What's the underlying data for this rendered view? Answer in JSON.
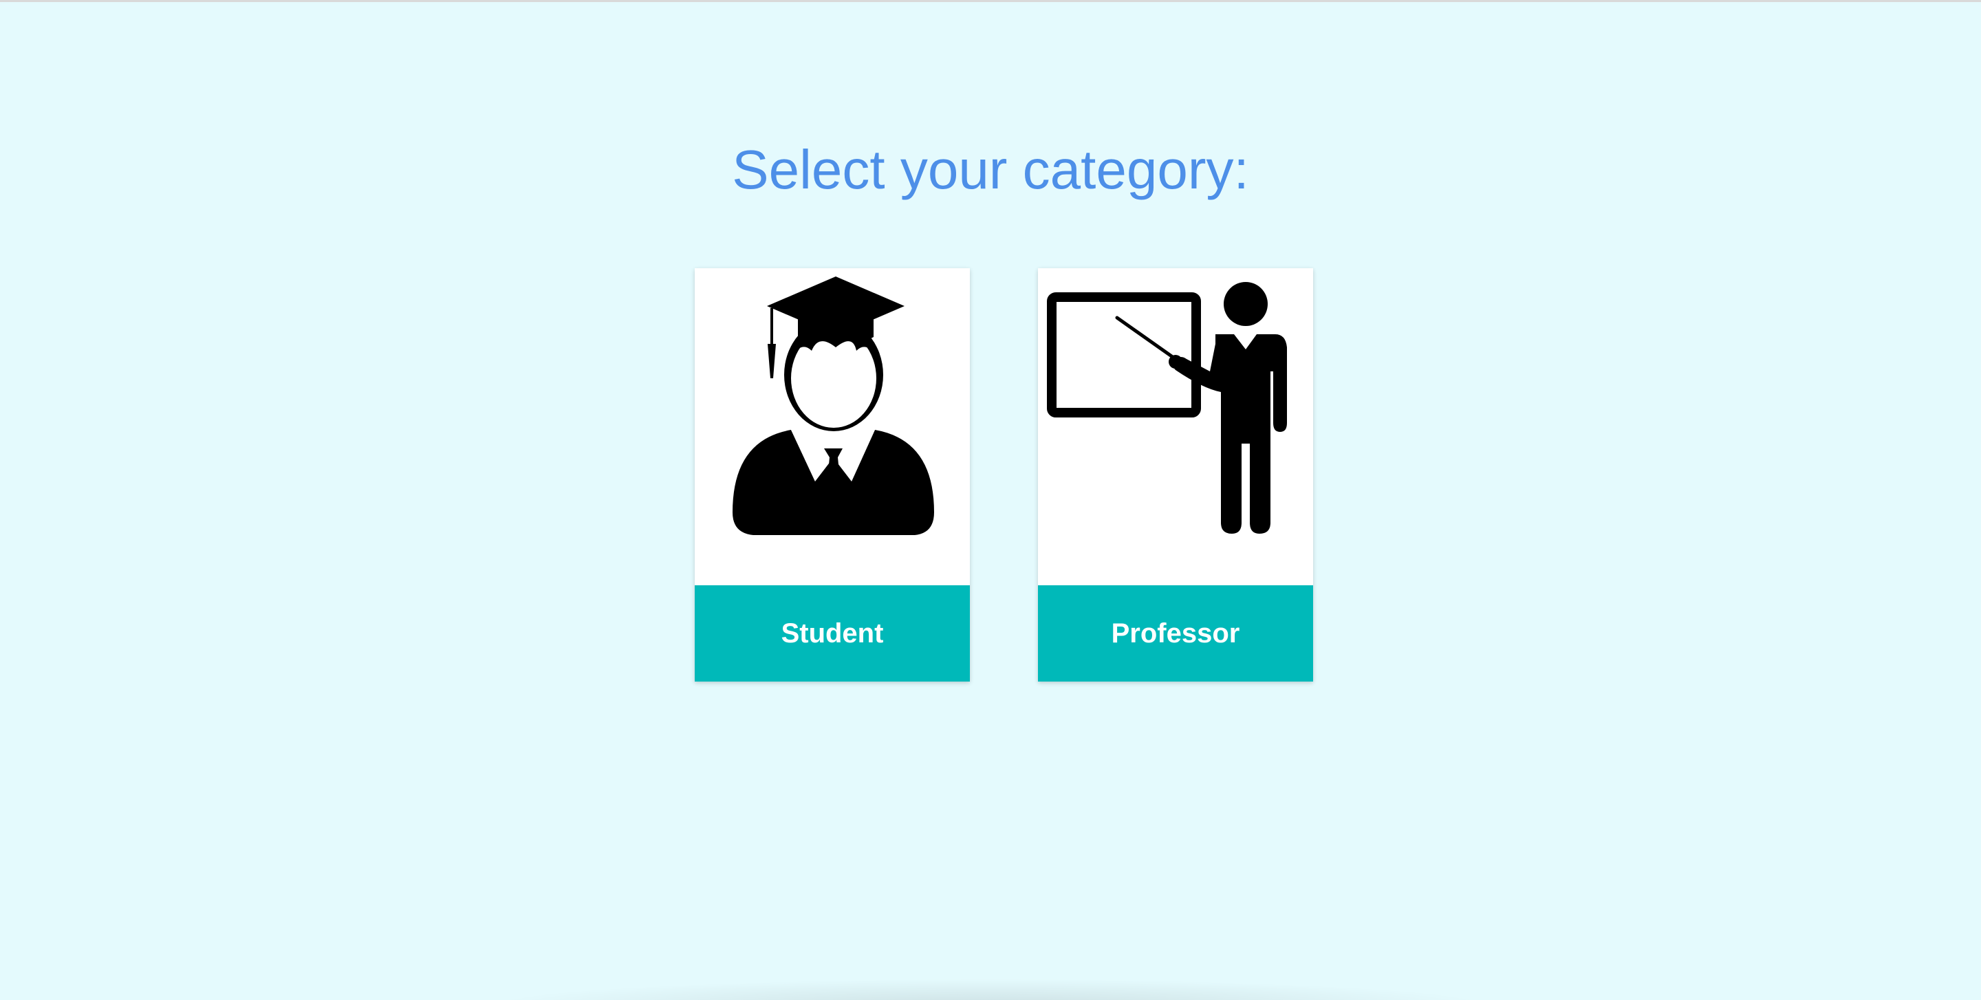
{
  "page": {
    "title": "Select your category:"
  },
  "categories": [
    {
      "label": "Student",
      "icon": "student-graduate-icon"
    },
    {
      "label": "Professor",
      "icon": "professor-teaching-icon"
    }
  ],
  "colors": {
    "background": "#e4fafd",
    "title": "#4d8fe8",
    "label_bar": "#00b9b9",
    "label_text": "#ffffff",
    "icon": "#000000"
  }
}
